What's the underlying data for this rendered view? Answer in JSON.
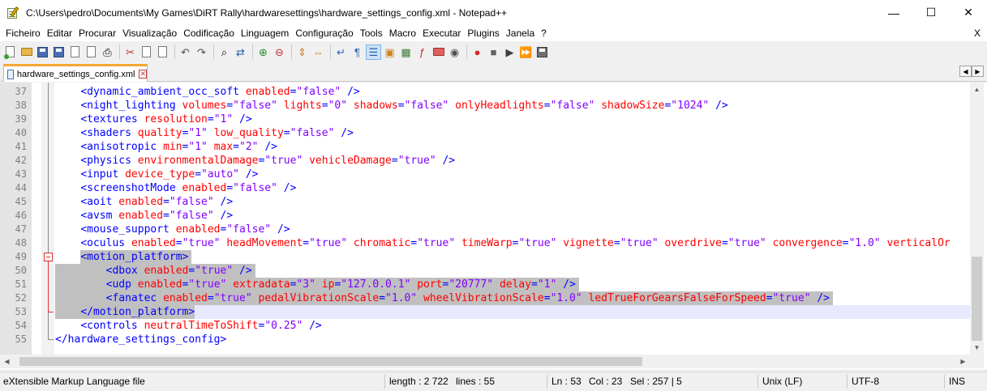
{
  "window": {
    "title": "C:\\Users\\pedro\\Documents\\My Games\\DiRT Rally\\hardwaresettings\\hardware_settings_config.xml - Notepad++",
    "minimize": "—",
    "maximize": "☐",
    "close": "✕"
  },
  "menu": {
    "items": [
      "Ficheiro",
      "Editar",
      "Procurar",
      "Visualização",
      "Codificação",
      "Linguagem",
      "Configuração",
      "Tools",
      "Macro",
      "Executar",
      "Plugins",
      "Janela",
      "?"
    ],
    "close": "X"
  },
  "toolbar": {
    "icons": [
      "new-file-icon",
      "open-folder-icon",
      "save-icon",
      "save-all-icon",
      "close-icon",
      "close-all-icon",
      "print-icon",
      "cut-icon",
      "copy-icon",
      "paste-icon",
      "undo-icon",
      "redo-icon",
      "find-icon",
      "replace-icon",
      "zoom-in-icon",
      "zoom-out-icon",
      "sync-vertical-icon",
      "sync-horizontal-icon",
      "word-wrap-icon",
      "show-all-chars-icon",
      "indent-guide-icon",
      "user-language-icon",
      "document-map-icon",
      "function-list-icon",
      "folder-workspace-icon",
      "monitoring-icon",
      "record-macro-icon",
      "stop-record-icon",
      "play-macro-icon",
      "run-macro-multiple-icon",
      "save-macro-icon"
    ]
  },
  "tab": {
    "label": "hardware_settings_config.xml",
    "close": "✕",
    "left_arrow": "◀",
    "right_arrow": "▶"
  },
  "editor": {
    "lines": [
      {
        "num": "37",
        "tokens": [
          [
            "p",
            "    "
          ],
          [
            "t",
            "<dynamic_ambient_occ_soft"
          ],
          [
            "p",
            " "
          ],
          [
            "a",
            "enabled"
          ],
          [
            "t",
            "="
          ],
          [
            "v",
            "\"false\""
          ],
          [
            "p",
            " "
          ],
          [
            "t",
            "/>"
          ]
        ]
      },
      {
        "num": "38",
        "tokens": [
          [
            "p",
            "    "
          ],
          [
            "t",
            "<night_lighting"
          ],
          [
            "p",
            " "
          ],
          [
            "a",
            "volumes"
          ],
          [
            "t",
            "="
          ],
          [
            "v",
            "\"false\""
          ],
          [
            "p",
            " "
          ],
          [
            "a",
            "lights"
          ],
          [
            "t",
            "="
          ],
          [
            "v",
            "\"0\""
          ],
          [
            "p",
            " "
          ],
          [
            "a",
            "shadows"
          ],
          [
            "t",
            "="
          ],
          [
            "v",
            "\"false\""
          ],
          [
            "p",
            " "
          ],
          [
            "a",
            "onlyHeadlights"
          ],
          [
            "t",
            "="
          ],
          [
            "v",
            "\"false\""
          ],
          [
            "p",
            " "
          ],
          [
            "a",
            "shadowSize"
          ],
          [
            "t",
            "="
          ],
          [
            "v",
            "\"1024\""
          ],
          [
            "p",
            " "
          ],
          [
            "t",
            "/>"
          ]
        ]
      },
      {
        "num": "39",
        "tokens": [
          [
            "p",
            "    "
          ],
          [
            "t",
            "<textures"
          ],
          [
            "p",
            " "
          ],
          [
            "a",
            "resolution"
          ],
          [
            "t",
            "="
          ],
          [
            "v",
            "\"1\""
          ],
          [
            "p",
            " "
          ],
          [
            "t",
            "/>"
          ]
        ]
      },
      {
        "num": "40",
        "tokens": [
          [
            "p",
            "    "
          ],
          [
            "t",
            "<shaders"
          ],
          [
            "p",
            " "
          ],
          [
            "a",
            "quality"
          ],
          [
            "t",
            "="
          ],
          [
            "v",
            "\"1\""
          ],
          [
            "p",
            " "
          ],
          [
            "a",
            "low_quality"
          ],
          [
            "t",
            "="
          ],
          [
            "v",
            "\"false\""
          ],
          [
            "p",
            " "
          ],
          [
            "t",
            "/>"
          ]
        ]
      },
      {
        "num": "41",
        "tokens": [
          [
            "p",
            "    "
          ],
          [
            "t",
            "<anisotropic"
          ],
          [
            "p",
            " "
          ],
          [
            "a",
            "min"
          ],
          [
            "t",
            "="
          ],
          [
            "v",
            "\"1\""
          ],
          [
            "p",
            " "
          ],
          [
            "a",
            "max"
          ],
          [
            "t",
            "="
          ],
          [
            "v",
            "\"2\""
          ],
          [
            "p",
            " "
          ],
          [
            "t",
            "/>"
          ]
        ]
      },
      {
        "num": "42",
        "tokens": [
          [
            "p",
            "    "
          ],
          [
            "t",
            "<physics"
          ],
          [
            "p",
            " "
          ],
          [
            "a",
            "environmentalDamage"
          ],
          [
            "t",
            "="
          ],
          [
            "v",
            "\"true\""
          ],
          [
            "p",
            " "
          ],
          [
            "a",
            "vehicleDamage"
          ],
          [
            "t",
            "="
          ],
          [
            "v",
            "\"true\""
          ],
          [
            "p",
            " "
          ],
          [
            "t",
            "/>"
          ]
        ]
      },
      {
        "num": "43",
        "tokens": [
          [
            "p",
            "    "
          ],
          [
            "t",
            "<input"
          ],
          [
            "p",
            " "
          ],
          [
            "a",
            "device_type"
          ],
          [
            "t",
            "="
          ],
          [
            "v",
            "\"auto\""
          ],
          [
            "p",
            " "
          ],
          [
            "t",
            "/>"
          ]
        ]
      },
      {
        "num": "44",
        "tokens": [
          [
            "p",
            "    "
          ],
          [
            "t",
            "<screenshotMode"
          ],
          [
            "p",
            " "
          ],
          [
            "a",
            "enabled"
          ],
          [
            "t",
            "="
          ],
          [
            "v",
            "\"false\""
          ],
          [
            "p",
            " "
          ],
          [
            "t",
            "/>"
          ]
        ]
      },
      {
        "num": "45",
        "tokens": [
          [
            "p",
            "    "
          ],
          [
            "t",
            "<aoit"
          ],
          [
            "p",
            " "
          ],
          [
            "a",
            "enabled"
          ],
          [
            "t",
            "="
          ],
          [
            "v",
            "\"false\""
          ],
          [
            "p",
            " "
          ],
          [
            "t",
            "/>"
          ]
        ]
      },
      {
        "num": "46",
        "tokens": [
          [
            "p",
            "    "
          ],
          [
            "t",
            "<avsm"
          ],
          [
            "p",
            " "
          ],
          [
            "a",
            "enabled"
          ],
          [
            "t",
            "="
          ],
          [
            "v",
            "\"false\""
          ],
          [
            "p",
            " "
          ],
          [
            "t",
            "/>"
          ]
        ]
      },
      {
        "num": "47",
        "tokens": [
          [
            "p",
            "    "
          ],
          [
            "t",
            "<mouse_support"
          ],
          [
            "p",
            " "
          ],
          [
            "a",
            "enabled"
          ],
          [
            "t",
            "="
          ],
          [
            "v",
            "\"false\""
          ],
          [
            "p",
            " "
          ],
          [
            "t",
            "/>"
          ]
        ]
      },
      {
        "num": "48",
        "tokens": [
          [
            "p",
            "    "
          ],
          [
            "t",
            "<oculus"
          ],
          [
            "p",
            " "
          ],
          [
            "a",
            "enabled"
          ],
          [
            "t",
            "="
          ],
          [
            "v",
            "\"true\""
          ],
          [
            "p",
            " "
          ],
          [
            "a",
            "headMovement"
          ],
          [
            "t",
            "="
          ],
          [
            "v",
            "\"true\""
          ],
          [
            "p",
            " "
          ],
          [
            "a",
            "chromatic"
          ],
          [
            "t",
            "="
          ],
          [
            "v",
            "\"true\""
          ],
          [
            "p",
            " "
          ],
          [
            "a",
            "timeWarp"
          ],
          [
            "t",
            "="
          ],
          [
            "v",
            "\"true\""
          ],
          [
            "p",
            " "
          ],
          [
            "a",
            "vignette"
          ],
          [
            "t",
            "="
          ],
          [
            "v",
            "\"true\""
          ],
          [
            "p",
            " "
          ],
          [
            "a",
            "overdrive"
          ],
          [
            "t",
            "="
          ],
          [
            "v",
            "\"true\""
          ],
          [
            "p",
            " "
          ],
          [
            "a",
            "convergence"
          ],
          [
            "t",
            "="
          ],
          [
            "v",
            "\"1.0\""
          ],
          [
            "p",
            " "
          ],
          [
            "a",
            "verticalOr"
          ]
        ]
      },
      {
        "num": "49",
        "tokens": [
          [
            "p",
            "    "
          ],
          [
            "t",
            "<motion_platform>"
          ]
        ]
      },
      {
        "num": "50",
        "tokens": [
          [
            "p",
            "        "
          ],
          [
            "t",
            "<dbox"
          ],
          [
            "p",
            " "
          ],
          [
            "a",
            "enabled"
          ],
          [
            "t",
            "="
          ],
          [
            "v",
            "\"true\""
          ],
          [
            "p",
            " "
          ],
          [
            "t",
            "/>"
          ]
        ]
      },
      {
        "num": "51",
        "tokens": [
          [
            "p",
            "        "
          ],
          [
            "t",
            "<udp"
          ],
          [
            "p",
            " "
          ],
          [
            "a",
            "enabled"
          ],
          [
            "t",
            "="
          ],
          [
            "v",
            "\"true\""
          ],
          [
            "p",
            " "
          ],
          [
            "a",
            "extradata"
          ],
          [
            "t",
            "="
          ],
          [
            "v",
            "\"3\""
          ],
          [
            "p",
            " "
          ],
          [
            "a",
            "ip"
          ],
          [
            "t",
            "="
          ],
          [
            "v",
            "\"127.0.0.1\""
          ],
          [
            "p",
            " "
          ],
          [
            "a",
            "port"
          ],
          [
            "t",
            "="
          ],
          [
            "v",
            "\"20777\""
          ],
          [
            "p",
            " "
          ],
          [
            "a",
            "delay"
          ],
          [
            "t",
            "="
          ],
          [
            "v",
            "\"1\""
          ],
          [
            "p",
            " "
          ],
          [
            "t",
            "/>"
          ]
        ]
      },
      {
        "num": "52",
        "tokens": [
          [
            "p",
            "        "
          ],
          [
            "t",
            "<fanatec"
          ],
          [
            "p",
            " "
          ],
          [
            "a",
            "enabled"
          ],
          [
            "t",
            "="
          ],
          [
            "v",
            "\"true\""
          ],
          [
            "p",
            " "
          ],
          [
            "a",
            "pedalVibrationScale"
          ],
          [
            "t",
            "="
          ],
          [
            "v",
            "\"1.0\""
          ],
          [
            "p",
            " "
          ],
          [
            "a",
            "wheelVibrationScale"
          ],
          [
            "t",
            "="
          ],
          [
            "v",
            "\"1.0\""
          ],
          [
            "p",
            " "
          ],
          [
            "a",
            "ledTrueForGearsFalseForSpeed"
          ],
          [
            "t",
            "="
          ],
          [
            "v",
            "\"true\""
          ],
          [
            "p",
            " "
          ],
          [
            "t",
            "/>"
          ]
        ]
      },
      {
        "num": "53",
        "tokens": [
          [
            "p",
            "    "
          ],
          [
            "t",
            "</motion_platform>"
          ]
        ]
      },
      {
        "num": "54",
        "tokens": [
          [
            "p",
            "    "
          ],
          [
            "t",
            "<controls"
          ],
          [
            "p",
            " "
          ],
          [
            "a",
            "neutralTimeToShift"
          ],
          [
            "t",
            "="
          ],
          [
            "v",
            "\"0.25\""
          ],
          [
            "p",
            " "
          ],
          [
            "t",
            "/>"
          ]
        ]
      },
      {
        "num": "55",
        "tokens": [
          [
            "t",
            "</hardware_settings_config>"
          ]
        ]
      }
    ]
  },
  "statusbar": {
    "file_type": "eXtensible Markup Language file",
    "length": "length : 2 722",
    "lines": "lines : 55",
    "ln": "Ln : 53",
    "col": "Col : 23",
    "sel": "Sel : 257 | 5",
    "eol": "Unix (LF)",
    "encoding": "UTF-8",
    "mode": "INS"
  },
  "colors": {
    "tag": "#0000ff",
    "attribute": "#ff0000",
    "value": "#8000ff",
    "selection": "#c0c0c0",
    "caret_line": "#e8e8ff",
    "tab_accent": "#f4a836"
  }
}
